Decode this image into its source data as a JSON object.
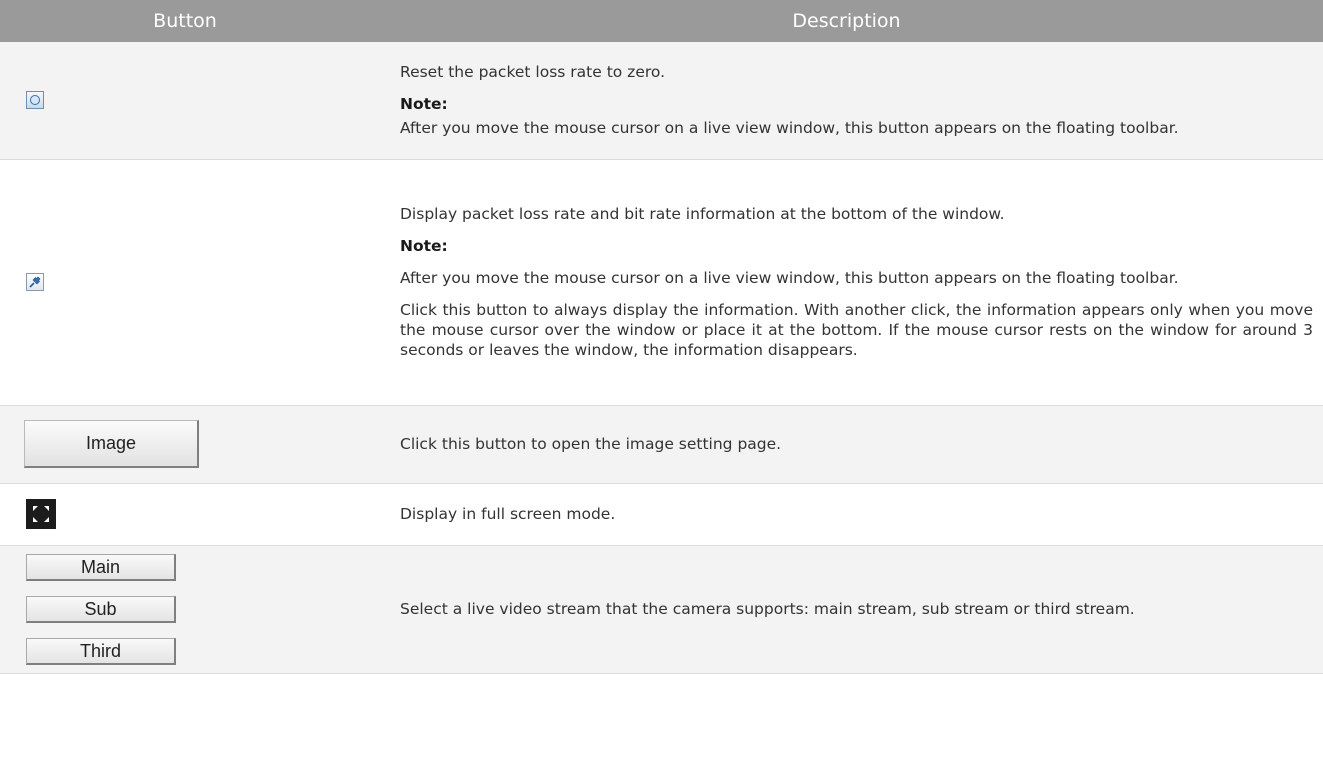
{
  "header": {
    "button_col": "Button",
    "description_col": "Description"
  },
  "rows": [
    {
      "button_icon": "reset-packet-loss-icon",
      "paragraphs": [
        "Reset the packet loss rate to zero."
      ],
      "note_label": "Note:",
      "note_paragraphs": [
        "After you move the mouse cursor on a live view window, this button appears on the floating toolbar."
      ]
    },
    {
      "button_icon": "pin-icon",
      "paragraphs": [
        "Display packet loss rate and bit rate information at the bottom of the window."
      ],
      "note_label": "Note:",
      "note_paragraphs": [
        "After you move the mouse cursor on a live view window, this button appears on the floating toolbar.",
        "Click this button to always display the information. With another click, the information appears only when you move the mouse cursor over the window or place it at the bottom. If the mouse cursor rests on the window for around 3 seconds or leaves the window, the information disappears."
      ]
    },
    {
      "button_label": "Image",
      "paragraphs": [
        "Click this button to open the image setting page."
      ]
    },
    {
      "button_icon": "fullscreen-icon",
      "paragraphs": [
        "Display in full screen mode."
      ]
    },
    {
      "button_labels": [
        "Main",
        "Sub",
        "Third"
      ],
      "paragraphs": [
        "Select a live video stream that the camera supports: main stream, sub stream or third stream."
      ]
    }
  ],
  "colors": {
    "header_bg": "#9a9a9a",
    "header_text": "#ffffff",
    "odd_row_bg": "#f3f3f3",
    "text": "#333333"
  }
}
